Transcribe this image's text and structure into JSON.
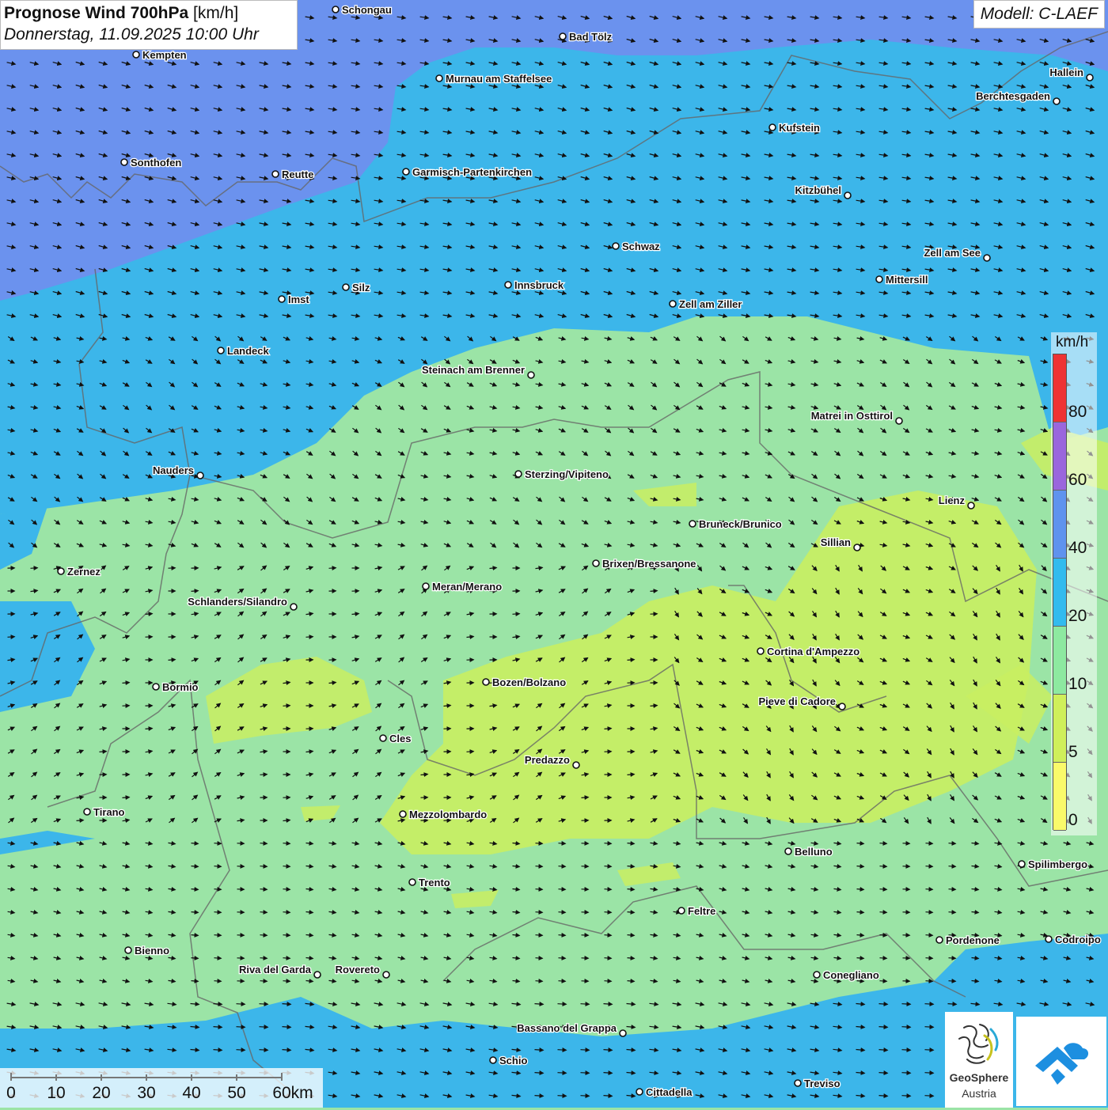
{
  "header": {
    "title_bold": "Prognose Wind 700hPa",
    "title_unit": "[km/h]",
    "datetime": "Donnerstag, 11.09.2025 10:00 Uhr"
  },
  "model": {
    "label": "Modell: C-LAEF"
  },
  "legend": {
    "unit": "km/h",
    "labels": [
      "80",
      "60",
      "40",
      "20",
      "10",
      "5",
      "0"
    ],
    "colors": [
      "#ee3333",
      "#9a66dd",
      "#5f93ee",
      "#33bbee",
      "#8de9a0",
      "#cfef5a",
      "#fafa6a"
    ]
  },
  "scalebar": {
    "labels": [
      "0",
      "10",
      "20",
      "30",
      "40",
      "50",
      "60km"
    ]
  },
  "logos": {
    "geosphere_line1": "GeoSphere",
    "geosphere_line2": "Austria"
  },
  "places": [
    {
      "name": "Schongau",
      "side": "r"
    },
    {
      "name": "Bad Tölz",
      "side": "r"
    },
    {
      "name": "Kempten",
      "side": "r"
    },
    {
      "name": "Murnau am Staffelsee",
      "side": "r"
    },
    {
      "name": "Hallein",
      "side": "l"
    },
    {
      "name": "Berchtesgaden",
      "side": "l"
    },
    {
      "name": "Kufstein",
      "side": "r"
    },
    {
      "name": "Sonthofen",
      "side": "r"
    },
    {
      "name": "Reutte",
      "side": "r"
    },
    {
      "name": "Garmisch-Partenkirchen",
      "side": "r"
    },
    {
      "name": "Kitzbühel",
      "side": "l"
    },
    {
      "name": "Schwaz",
      "side": "r"
    },
    {
      "name": "Zell am See",
      "side": "l"
    },
    {
      "name": "Mittersill",
      "side": "r"
    },
    {
      "name": "Imst",
      "side": "r"
    },
    {
      "name": "Silz",
      "side": "r"
    },
    {
      "name": "Innsbruck",
      "side": "r"
    },
    {
      "name": "Zell am Ziller",
      "side": "r"
    },
    {
      "name": "Landeck",
      "side": "r"
    },
    {
      "name": "Steinach am Brenner",
      "side": "l"
    },
    {
      "name": "Matrei in Osttirol",
      "side": "l"
    },
    {
      "name": "Nauders",
      "side": "l"
    },
    {
      "name": "Sterzing/Vipiteno",
      "side": "r"
    },
    {
      "name": "Lienz",
      "side": "l"
    },
    {
      "name": "Bruneck/Brunico",
      "side": "r"
    },
    {
      "name": "Sillian",
      "side": "l"
    },
    {
      "name": "Zernez",
      "side": "r"
    },
    {
      "name": "Brixen/Bressanone",
      "side": "r"
    },
    {
      "name": "Meran/Merano",
      "side": "r"
    },
    {
      "name": "Schlanders/Silandro",
      "side": "l"
    },
    {
      "name": "Cortina d'Ampezzo",
      "side": "r"
    },
    {
      "name": "Bozen/Bolzano",
      "side": "r"
    },
    {
      "name": "Bormio",
      "side": "r"
    },
    {
      "name": "Pieve di Cadore",
      "side": "l"
    },
    {
      "name": "Cles",
      "side": "r"
    },
    {
      "name": "Predazzo",
      "side": "l"
    },
    {
      "name": "Tirano",
      "side": "r"
    },
    {
      "name": "Mezzolombardo",
      "side": "r"
    },
    {
      "name": "Belluno",
      "side": "r"
    },
    {
      "name": "Spilimbergo",
      "side": "r"
    },
    {
      "name": "Trento",
      "side": "r"
    },
    {
      "name": "Feltre",
      "side": "r"
    },
    {
      "name": "Bienno",
      "side": "r"
    },
    {
      "name": "Pordenone",
      "side": "r"
    },
    {
      "name": "Codroipo",
      "side": "r"
    },
    {
      "name": "Riva del Garda",
      "side": "l"
    },
    {
      "name": "Rovereto",
      "side": "l"
    },
    {
      "name": "Conegliano",
      "side": "r"
    },
    {
      "name": "Bassano del Grappa",
      "side": "l"
    },
    {
      "name": "Schio",
      "side": "r"
    },
    {
      "name": "Treviso",
      "side": "r"
    },
    {
      "name": "Cittadella",
      "side": "r"
    }
  ]
}
